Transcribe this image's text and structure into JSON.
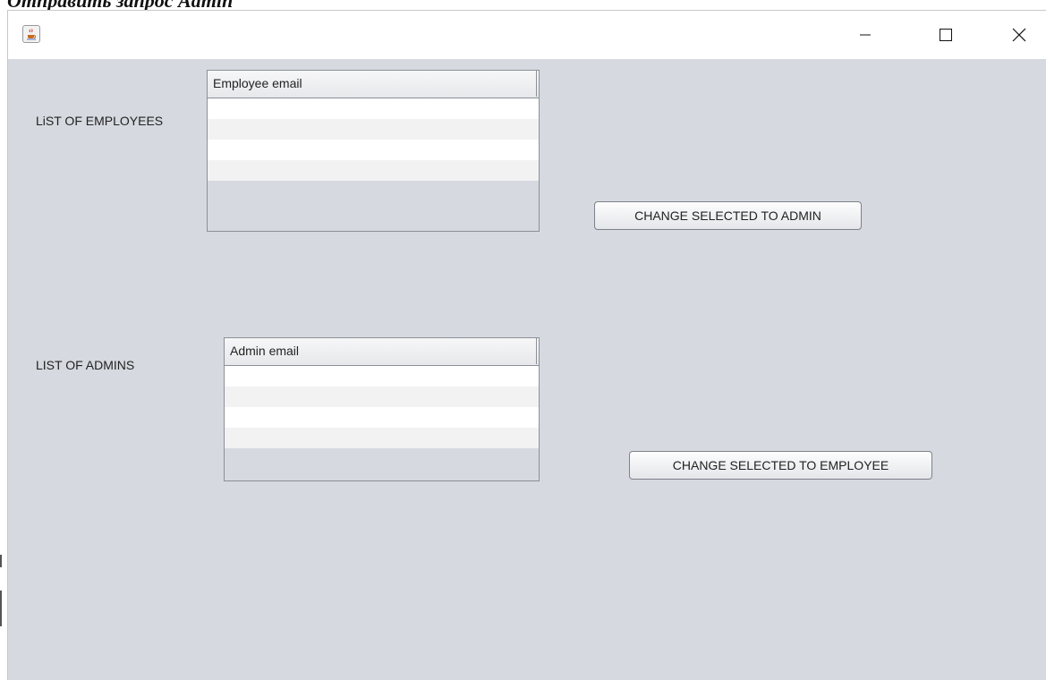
{
  "background_fragment": "Отправить запрос Admin",
  "window": {
    "title_icon": "java-coffee-icon",
    "controls": {
      "minimize": "—",
      "maximize": "☐",
      "close": "✕"
    }
  },
  "employees": {
    "label": "LiST OF EMPLOYEES",
    "column": "Employee email",
    "rows": [
      "",
      "",
      "",
      ""
    ]
  },
  "admins": {
    "label": "LIST OF ADMINS",
    "column": "Admin email",
    "rows": [
      "",
      "",
      "",
      ""
    ]
  },
  "buttons": {
    "to_admin": "CHANGE SELECTED TO ADMIN",
    "to_employee": "CHANGE SELECTED TO EMPLOYEE"
  },
  "colors": {
    "panel_bg": "#d6d9df",
    "row_alt": "#f2f2f2",
    "border": "#8c9097"
  }
}
